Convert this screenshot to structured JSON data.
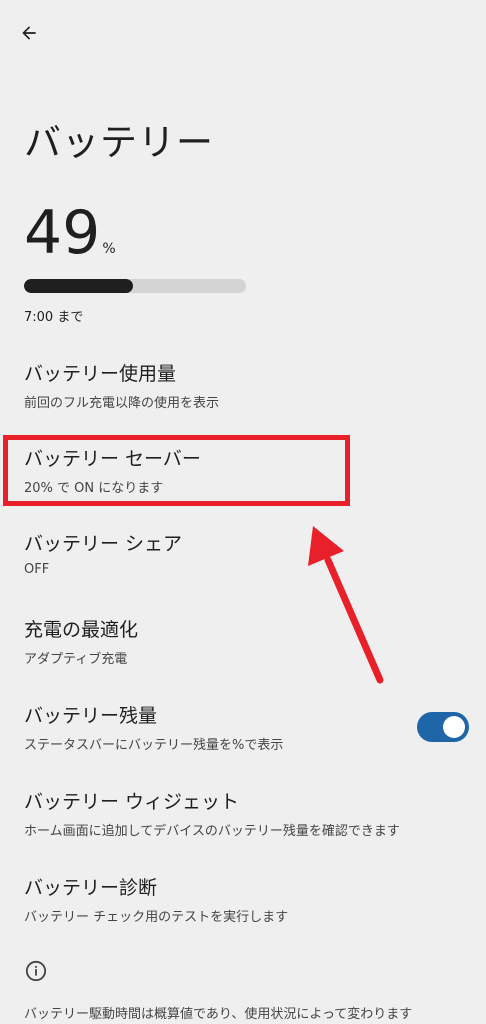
{
  "header": {
    "back_icon": "arrow-left-icon",
    "title": "バッテリー"
  },
  "battery": {
    "level": "49",
    "unit": "%",
    "level_fraction": 0.49,
    "until": "7:00 まで"
  },
  "items": [
    {
      "title": "バッテリー使用量",
      "subtitle": "前回のフル充電以降の使用を表示"
    },
    {
      "title": "バッテリー セーバー",
      "subtitle": "20% で ON になります"
    },
    {
      "title": "バッテリー シェア",
      "subtitle": "OFF"
    },
    {
      "title": "充電の最適化",
      "subtitle": "アダプティブ充電"
    },
    {
      "title": "バッテリー残量",
      "subtitle": "ステータスバーにバッテリー残量を%で表示",
      "toggle_on": true
    },
    {
      "title": "バッテリー ウィジェット",
      "subtitle": "ホーム画面に追加してデバイスのバッテリー残量を確認できます"
    },
    {
      "title": "バッテリー診断",
      "subtitle": "バッテリー チェック用のテストを実行します"
    }
  ],
  "footer": {
    "info_icon": "info-icon",
    "note": "バッテリー駆動時間は概算値であり、使用状況によって変わります"
  },
  "colors": {
    "background": "#efefef",
    "highlight": "#e8202a",
    "toggle": "#1e66a8"
  }
}
